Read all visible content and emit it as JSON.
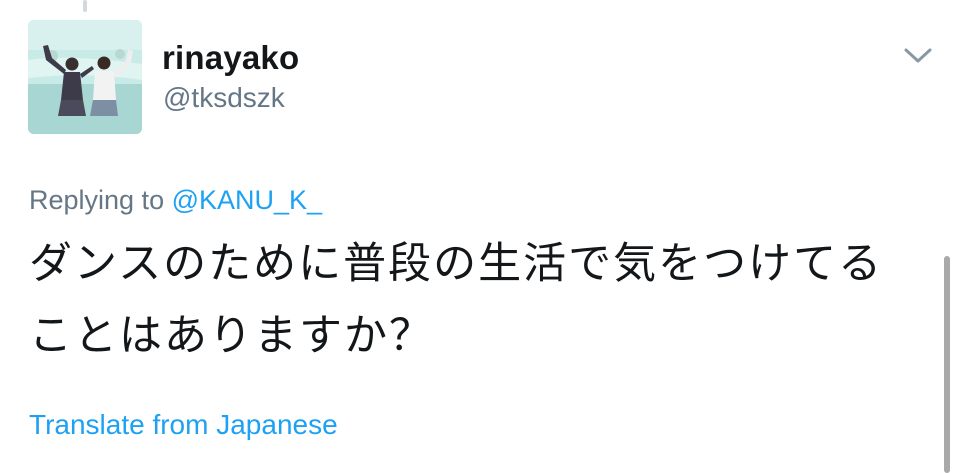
{
  "user": {
    "display_name": "rinayako",
    "handle": "@tksdszk"
  },
  "reply": {
    "prefix": "Replying to",
    "mention": "@KANU_K_"
  },
  "tweet": {
    "text": "ダンスのために普段の生活で気をつけてることはありますか？"
  },
  "translate_label": "Translate from Japanese",
  "icons": {
    "menu": "chevron-down-icon"
  },
  "colors": {
    "link": "#1da1f2",
    "secondary_text": "#657786",
    "primary_text": "#14171a"
  }
}
